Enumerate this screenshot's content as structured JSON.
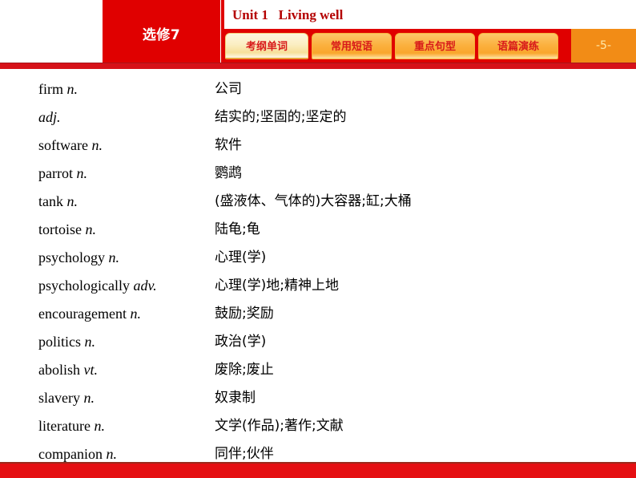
{
  "header": {
    "volume_label": "选修7",
    "unit_title": "Unit 1   Living well",
    "page_number": "-5-",
    "tabs": [
      {
        "label": "考纲单词",
        "active": true
      },
      {
        "label": "常用短语",
        "active": false
      },
      {
        "label": "重点句型",
        "active": false
      },
      {
        "label": "语篇演练",
        "active": false
      }
    ]
  },
  "colors": {
    "brand_red": "#e00000",
    "rule_red": "#d61118",
    "title_red": "#b40000",
    "tab_text_red": "#d81a1a",
    "page_plate_orange": "#f28c16",
    "page_number_cream": "#ffe9a8",
    "footer_red": "#e50f12"
  },
  "wordlist": [
    {
      "word": "firm",
      "pos": "n.",
      "meaning": "公司"
    },
    {
      "word": "",
      "pos": "adj.",
      "meaning": "结实的;坚固的;坚定的"
    },
    {
      "word": "software",
      "pos": "n.",
      "meaning": "软件"
    },
    {
      "word": "parrot",
      "pos": "n.",
      "meaning": "鹦鹉"
    },
    {
      "word": "tank",
      "pos": "n.",
      "meaning": "(盛液体、气体的)大容器;缸;大桶"
    },
    {
      "word": "tortoise",
      "pos": "n.",
      "meaning": "陆龟;龟"
    },
    {
      "word": "psychology",
      "pos": "n.",
      "meaning": "心理(学)"
    },
    {
      "word": "psychologically",
      "pos": "adv.",
      "meaning": "心理(学)地;精神上地"
    },
    {
      "word": "encouragement",
      "pos": "n.",
      "meaning": "鼓励;奖励"
    },
    {
      "word": "politics",
      "pos": "n.",
      "meaning": "政治(学)"
    },
    {
      "word": "abolish",
      "pos": "vt.",
      "meaning": "废除;废止"
    },
    {
      "word": "slavery",
      "pos": "n.",
      "meaning": "奴隶制"
    },
    {
      "word": "literature",
      "pos": "n.",
      "meaning": "文学(作品);著作;文献"
    },
    {
      "word": "companion",
      "pos": "n.",
      "meaning": "同伴;伙伴"
    }
  ]
}
